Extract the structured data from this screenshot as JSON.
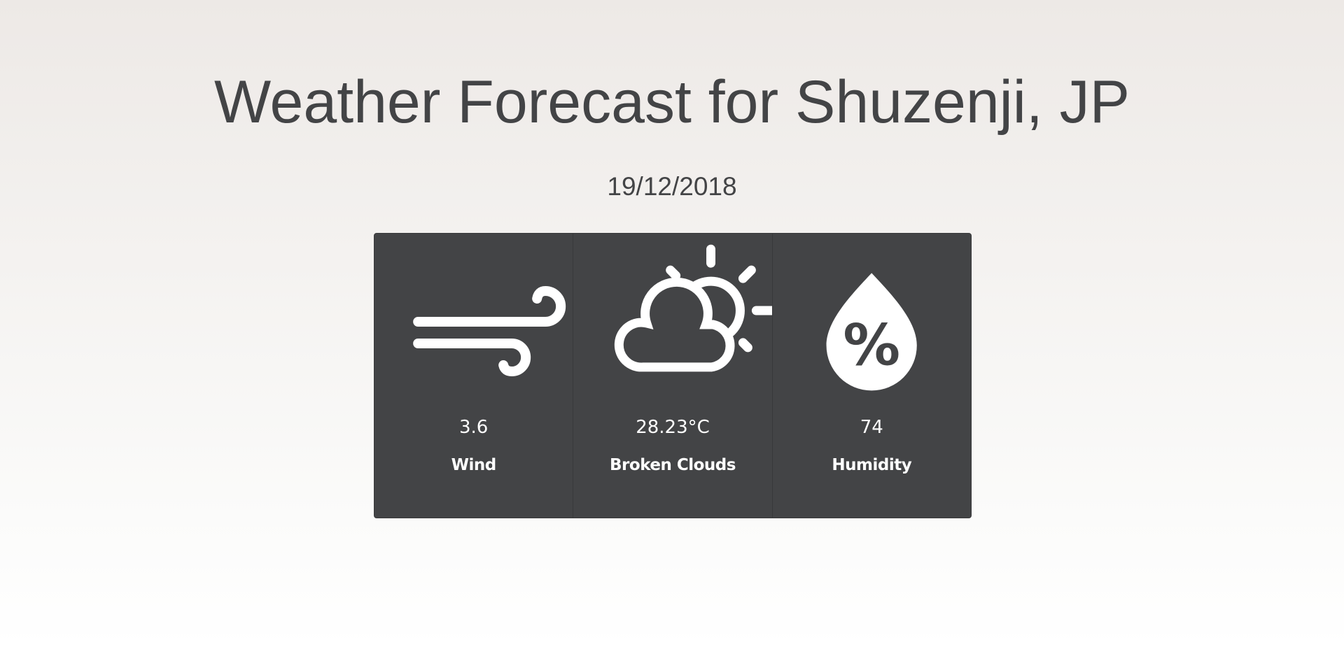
{
  "page": {
    "title": "Weather Forecast for Shuzenji, JP",
    "date": "19/12/2018"
  },
  "cards": [
    {
      "icon": "wind-icon",
      "value": "3.6",
      "label": "Wind"
    },
    {
      "icon": "partly-cloudy-icon",
      "value": "28.23°C",
      "label": "Broken Clouds"
    },
    {
      "icon": "humidity-drop-icon",
      "value": "74",
      "label": "Humidity",
      "icon_text": "%"
    }
  ],
  "colors": {
    "card": "#434446",
    "text": "#434446",
    "icon": "#ffffff"
  }
}
